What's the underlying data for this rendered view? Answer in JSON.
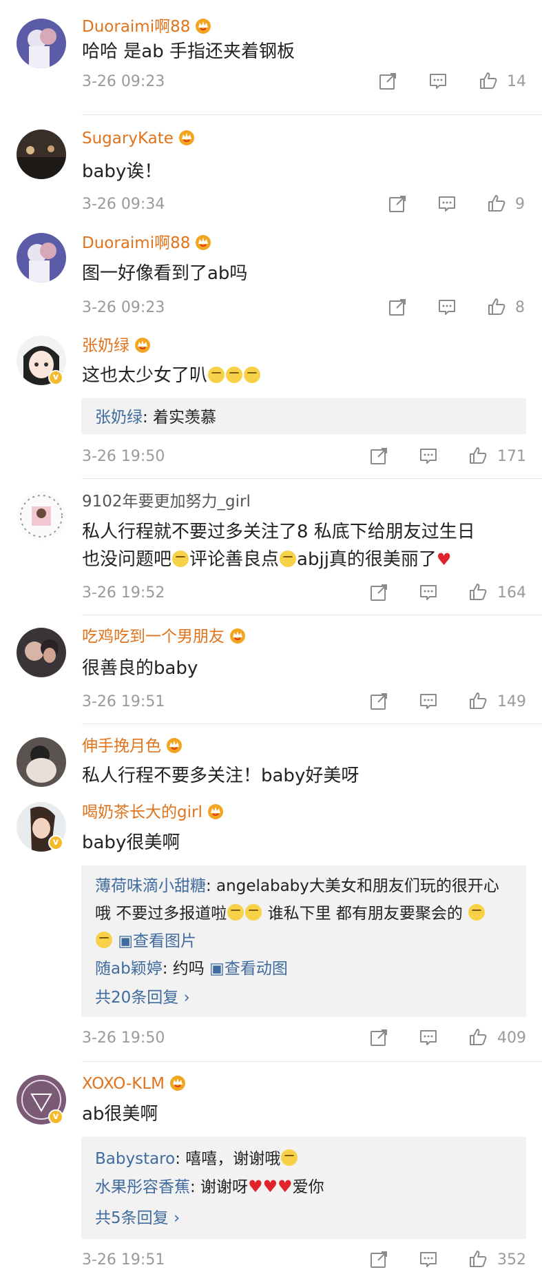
{
  "comments": [
    {
      "user": "Duoraimi啊88",
      "text": "哈哈 是ab 手指还夹着钢板",
      "time": "3-26 09:23",
      "likes": "14"
    },
    {
      "user": "SugaryKate",
      "text": "baby诶！",
      "time": "3-26 09:34",
      "likes": "9"
    },
    {
      "user": "Duoraimi啊88",
      "text": "图一好像看到了ab吗",
      "time": "3-26 09:23",
      "likes": "8"
    },
    {
      "user": "张奶绿",
      "text": "这也太少女了叭",
      "time": "3-26 19:50",
      "likes": "171",
      "replies": [
        {
          "name": "张奶绿",
          "text": ": 着实羡慕"
        }
      ]
    },
    {
      "user": "9102年要更加努力_girl",
      "text_line1": "私人行程就不要过多关注了8  私底下给朋友过生日",
      "text_line2_a": "也没问题吧",
      "text_line2_b": "评论善良点",
      "text_line2_c": "abjj真的很美丽了",
      "time": "3-26 19:52",
      "likes": "164"
    },
    {
      "user": "吃鸡吃到一个男朋友",
      "text": "很善良的baby",
      "time": "3-26 19:51",
      "likes": "149"
    },
    {
      "user": "伸手挽月色",
      "text": "私人行程不要多关注！baby好美呀"
    },
    {
      "user": "喝奶茶长大的girl",
      "text": "baby很美啊",
      "time": "3-26 19:50",
      "likes": "409",
      "replies": [
        {
          "name": "薄荷味滴小甜糖",
          "text": ": angelababy大美女和朋友们玩的很开心",
          "line2": "哦  不要过多报道啦",
          "line2b": "  谁私下里 都有朋友要聚会的 ",
          "link": "查看图片"
        },
        {
          "name": "随ab颖婷",
          "text": ": 约吗 ",
          "link": "查看动图"
        }
      ],
      "more": "共20条回复 ›"
    },
    {
      "user": "XOXO-KLM",
      "text": "ab很美啊",
      "time": "3-26 19:51",
      "likes": "352",
      "replies": [
        {
          "name": "Babystaro",
          "text": ": 嘻嘻，谢谢哦"
        },
        {
          "name": "水果彤容香蕉",
          "text": ": 谢谢呀",
          "tail": "爱你"
        }
      ],
      "more": "共5条回复 ›"
    }
  ],
  "icons": {
    "share": "share-icon",
    "comment": "comment-icon",
    "like": "thumbs-up-icon",
    "crown": "vip-crown-icon",
    "verified": "verified-v-icon"
  },
  "colors": {
    "username": "#e0731b",
    "link": "#3f6b9e",
    "meta": "#9a9a9a",
    "reply_bg": "#f2f2f2",
    "verified": "#f6b92b"
  }
}
